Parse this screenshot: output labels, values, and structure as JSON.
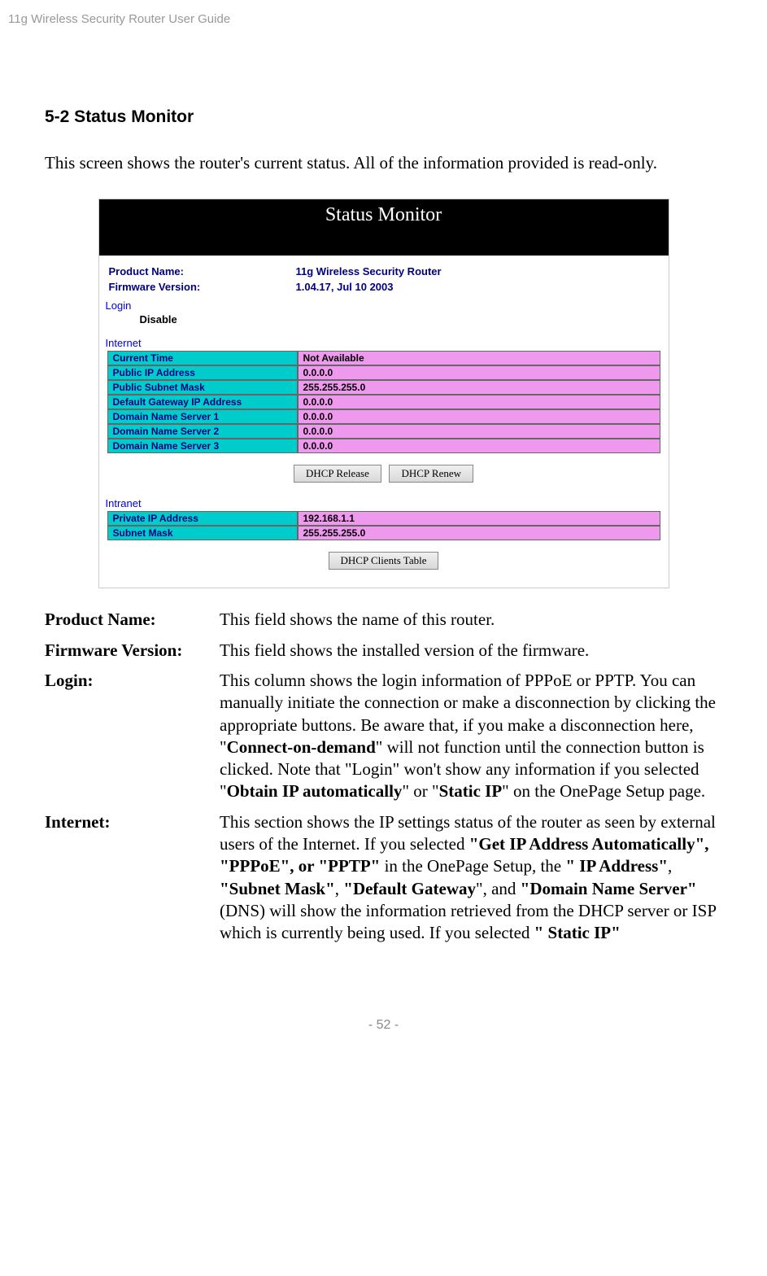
{
  "header": "11g Wireless Security Router User Guide",
  "section_title": "5-2 Status Monitor",
  "intro": "This screen shows the router's current status. All of the information provided is read-only.",
  "screenshot": {
    "title": "Status Monitor",
    "product_name_label": "Product Name:",
    "product_name_value": "11g Wireless Security Router",
    "fw_label": "Firmware Version:",
    "fw_value": "1.04.17, Jul 10 2003",
    "login_header": "Login",
    "login_value": "Disable",
    "internet_header": "Internet",
    "internet_rows": [
      {
        "label": "Current Time",
        "value": "Not Available"
      },
      {
        "label": "Public IP Address",
        "value": "0.0.0.0"
      },
      {
        "label": "Public Subnet Mask",
        "value": "255.255.255.0"
      },
      {
        "label": "Default Gateway IP Address",
        "value": "0.0.0.0"
      },
      {
        "label": "Domain Name Server 1",
        "value": "0.0.0.0"
      },
      {
        "label": "Domain Name Server 2",
        "value": "0.0.0.0"
      },
      {
        "label": "Domain Name Server 3",
        "value": "0.0.0.0"
      }
    ],
    "btn_release": "DHCP Release",
    "btn_renew": "DHCP Renew",
    "intranet_header": "Intranet",
    "intranet_rows": [
      {
        "label": "Private IP Address",
        "value": "192.168.1.1"
      },
      {
        "label": "Subnet Mask",
        "value": "255.255.255.0"
      }
    ],
    "btn_clients": "DHCP Clients Table"
  },
  "descriptions": {
    "product_name_term": "Product Name:",
    "product_name_def": "This field shows the name of this router.",
    "firmware_term": "Firmware Version:",
    "firmware_def": "This field shows the installed version of the firmware.",
    "login_term": "Login:",
    "login_def_1": "This column shows the login information of PPPoE or PPTP. You can manually initiate the connection or make a disconnection by clicking the appropriate buttons. Be aware that, if you make a disconnection here, \"",
    "login_bold_1": "Connect-on-demand",
    "login_def_2": "\" will not function until the connection button is clicked. Note that \"Login\" won't show any information if you selected \"",
    "login_bold_2": "Obtain IP automatically",
    "login_def_3": "\" or \"",
    "login_bold_3": "Static IP",
    "login_def_4": "\" on the OnePage Setup page.",
    "internet_term": "Internet:",
    "internet_def_1": "This section shows the IP settings status of the router as seen by external users of the Internet. If you selected ",
    "internet_bold_1": "\"Get IP Address Automatically\", \"PPPoE\", or \"PPTP\"",
    "internet_def_2": " in the OnePage Setup, the ",
    "internet_bold_2": "\" IP Address\"",
    "internet_def_3": ", ",
    "internet_bold_3": "\"Subnet Mask\"",
    "internet_def_4": ", ",
    "internet_bold_4": "\"Default Gateway",
    "internet_def_5": "\", and ",
    "internet_bold_5": "\"Domain Name Server\"",
    "internet_def_6": " (DNS) will show the information retrieved from the DHCP server or ISP which is currently being used. If you selected ",
    "internet_bold_6": "\" Static IP\""
  },
  "footer": "- 52 -"
}
